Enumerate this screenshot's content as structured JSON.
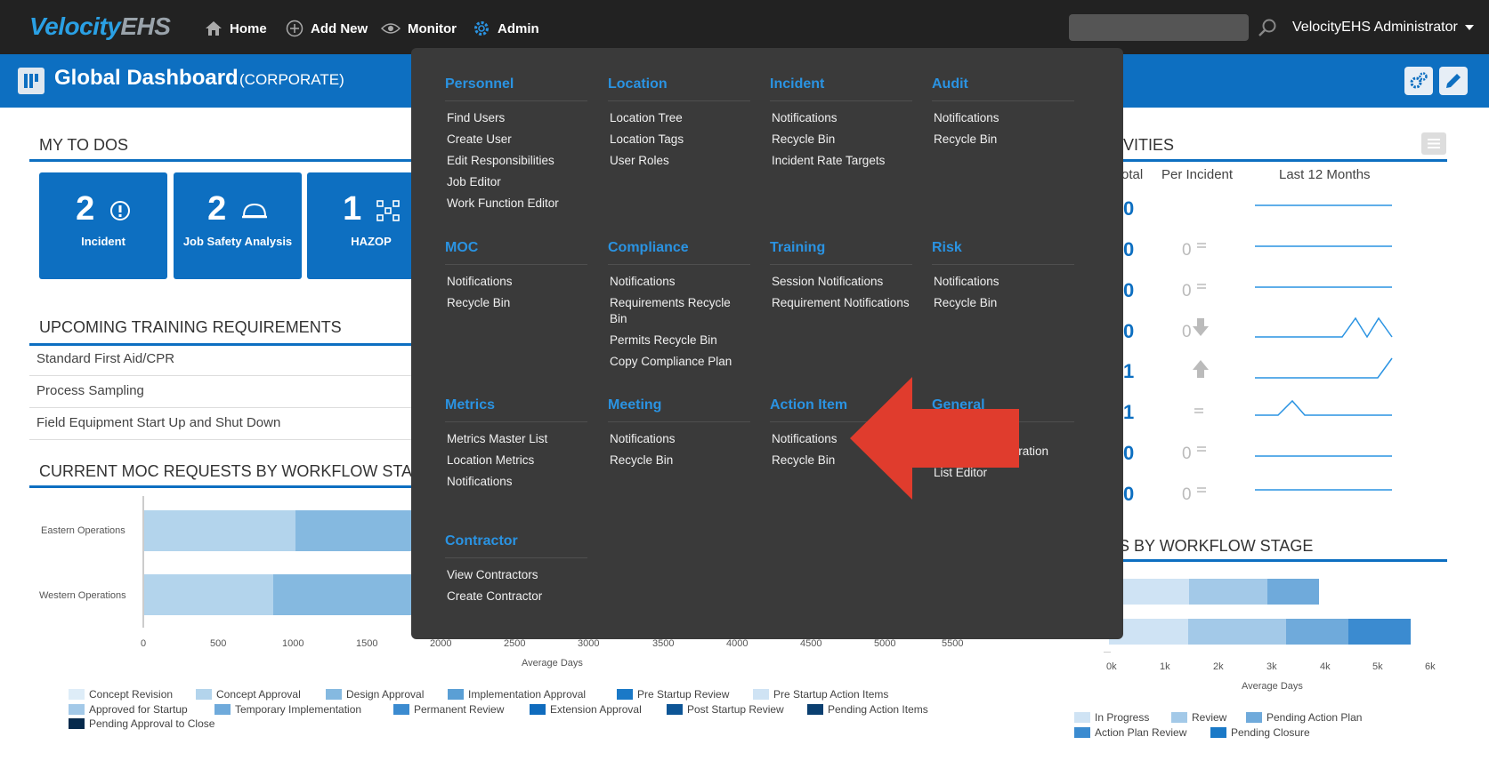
{
  "nav": {
    "logo_a": "Velocity",
    "logo_b": "EHS",
    "home": "Home",
    "add_new": "Add New",
    "monitor": "Monitor",
    "admin": "Admin",
    "search_value": "",
    "user": "VelocityEHS Administrator"
  },
  "header": {
    "title": "Global Dashboard",
    "subtitle": "(CORPORATE)"
  },
  "todos": {
    "title": "MY TO DOS",
    "tiles": [
      {
        "count": "2",
        "label": "Incident"
      },
      {
        "count": "2",
        "label": "Job Safety Analysis"
      },
      {
        "count": "1",
        "label": "HAZOP"
      }
    ]
  },
  "training": {
    "title": "UPCOMING TRAINING REQUIREMENTS",
    "rows": [
      "Standard First Aid/CPR",
      "Process Sampling",
      "Field Equipment Start Up and Shut Down"
    ]
  },
  "moc_chart": {
    "title": "CURRENT MOC REQUESTS BY WORKFLOW STAGE",
    "xlabel": "Average Days",
    "categories": [
      "Eastern Operations",
      "Western Operations"
    ],
    "ticks": [
      "0",
      "500",
      "1000",
      "1500",
      "2000",
      "2500",
      "3000",
      "3500",
      "4000",
      "4500",
      "5000",
      "5500"
    ],
    "legend": [
      {
        "name": "Concept Revision",
        "color": "#deedf8"
      },
      {
        "name": "Concept Approval",
        "color": "#b3d4ec"
      },
      {
        "name": "Design Approval",
        "color": "#85b9e0"
      },
      {
        "name": "Implementation Approval",
        "color": "#5a9fd5"
      },
      {
        "name": "Pre Startup Review",
        "color": "#1a79c7"
      },
      {
        "name": "Pre Startup Action Items",
        "color": "#cfe3f4"
      },
      {
        "name": "Approved for Startup",
        "color": "#a3c9e8"
      },
      {
        "name": "Temporary Implementation",
        "color": "#6faadb"
      },
      {
        "name": "Permanent Review",
        "color": "#3b8bd0"
      },
      {
        "name": "Extension Approval",
        "color": "#0f6bbd"
      },
      {
        "name": "Post Startup Review",
        "color": "#0d5596"
      },
      {
        "name": "Pending Action Items",
        "color": "#0a3f70"
      },
      {
        "name": "Pending Approval to Close",
        "color": "#062a4c"
      }
    ]
  },
  "activities": {
    "title_fragment": "TIVITIES",
    "col_total": "otal",
    "col_per": "Per Incident",
    "col_last": "Last 12 Months",
    "totals": [
      "0",
      "0",
      "0",
      "0",
      "1",
      "1",
      "0",
      "0"
    ],
    "per_incident": [
      "",
      "0",
      "0",
      "0",
      "",
      "",
      "0",
      "0"
    ]
  },
  "incident_chart": {
    "title_fragment": "TS BY WORKFLOW STAGE",
    "xlabel": "Average Days",
    "ticks": [
      "0k",
      "1k",
      "2k",
      "3k",
      "4k",
      "5k",
      "6k"
    ],
    "legend": [
      {
        "name": "In Progress",
        "color": "#cfe3f4"
      },
      {
        "name": "Review",
        "color": "#a3c9e8"
      },
      {
        "name": "Pending Action Plan",
        "color": "#6faadb"
      },
      {
        "name": "Action Plan Review",
        "color": "#3b8bd0"
      },
      {
        "name": "Pending Closure",
        "color": "#1a79c7"
      }
    ]
  },
  "admin_menu": {
    "columns": [
      {
        "head": "Personnel",
        "items": [
          "Find Users",
          "Create User",
          "Edit Responsibilities",
          "Job Editor",
          "Work Function Editor"
        ]
      },
      {
        "head": "Location",
        "items": [
          "Location Tree",
          "Location Tags",
          "User Roles"
        ]
      },
      {
        "head": "Incident",
        "items": [
          "Notifications",
          "Recycle Bin",
          "Incident Rate Targets"
        ]
      },
      {
        "head": "Audit",
        "items": [
          "Notifications",
          "Recycle Bin"
        ]
      },
      {
        "head": "MOC",
        "items": [
          "Notifications",
          "Recycle Bin"
        ]
      },
      {
        "head": "Compliance",
        "items": [
          "Notifications",
          "Requirements Recycle Bin",
          "Permits Recycle Bin",
          "Copy Compliance Plan"
        ]
      },
      {
        "head": "Training",
        "items": [
          "Session Notifications",
          "Requirement Notifications"
        ]
      },
      {
        "head": "Risk",
        "items": [
          "Notifications",
          "Recycle Bin"
        ]
      },
      {
        "head": "Metrics",
        "items": [
          "Metrics Master List",
          "Location Metrics",
          "Notifications"
        ]
      },
      {
        "head": "Meeting",
        "items": [
          "Notifications",
          "Recycle Bin"
        ]
      },
      {
        "head": "Action Item",
        "items": [
          "Notifications",
          "Recycle Bin"
        ]
      },
      {
        "head": "General",
        "items": [
          "Report Administration",
          "List Editor"
        ]
      },
      {
        "head": "Contractor",
        "items": [
          "View Contractors",
          "Create Contractor"
        ]
      }
    ]
  },
  "colors": {
    "brand_blue": "#0d6fc1",
    "menu_head": "#2a93e2",
    "arrow": "#e03c2d"
  }
}
